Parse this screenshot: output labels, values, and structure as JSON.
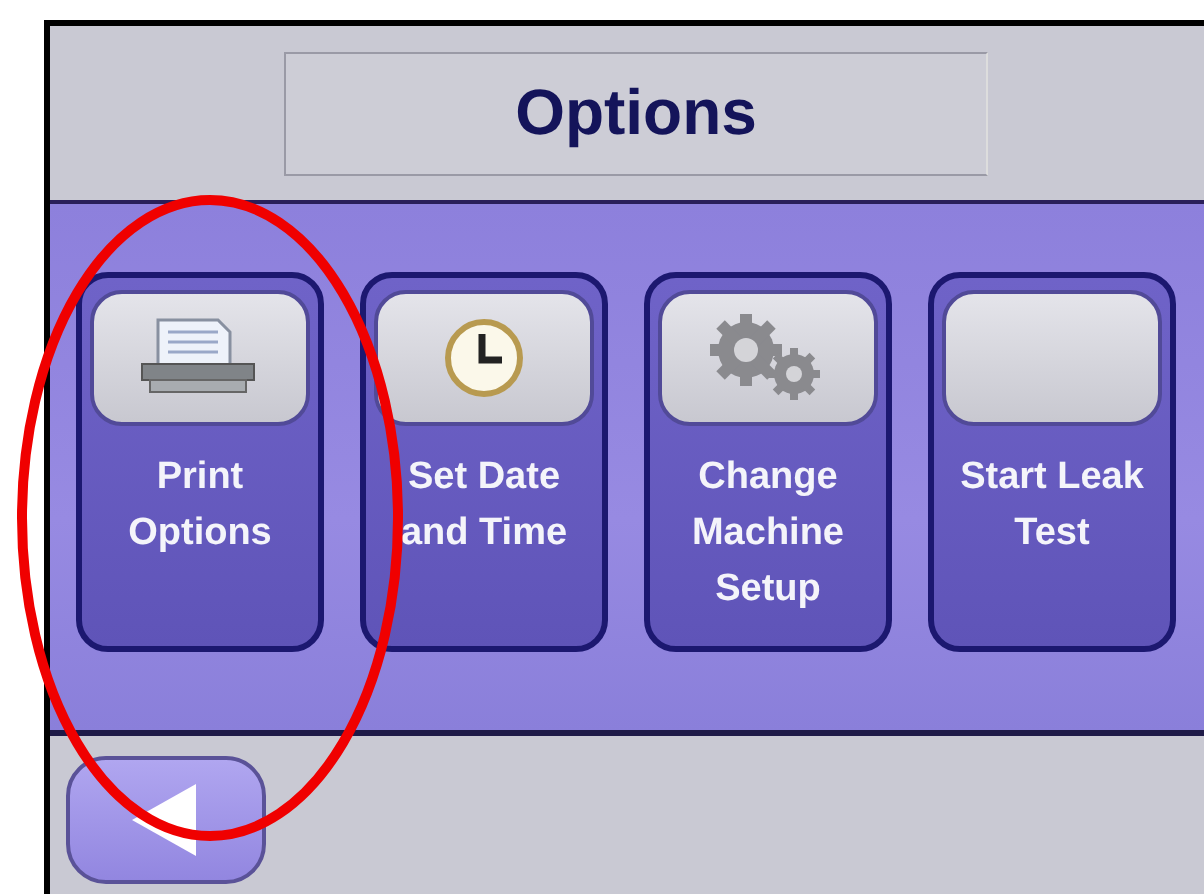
{
  "header": {
    "title": "Options"
  },
  "tiles": [
    {
      "label": "Print Options",
      "kind": "printer"
    },
    {
      "label": "Set Date and Time",
      "kind": "clock"
    },
    {
      "label": "Change Machine Setup",
      "kind": "gears"
    },
    {
      "label": "Start Leak Test",
      "kind": "blank"
    }
  ],
  "footer": {
    "back": {
      "kind": "back"
    }
  }
}
